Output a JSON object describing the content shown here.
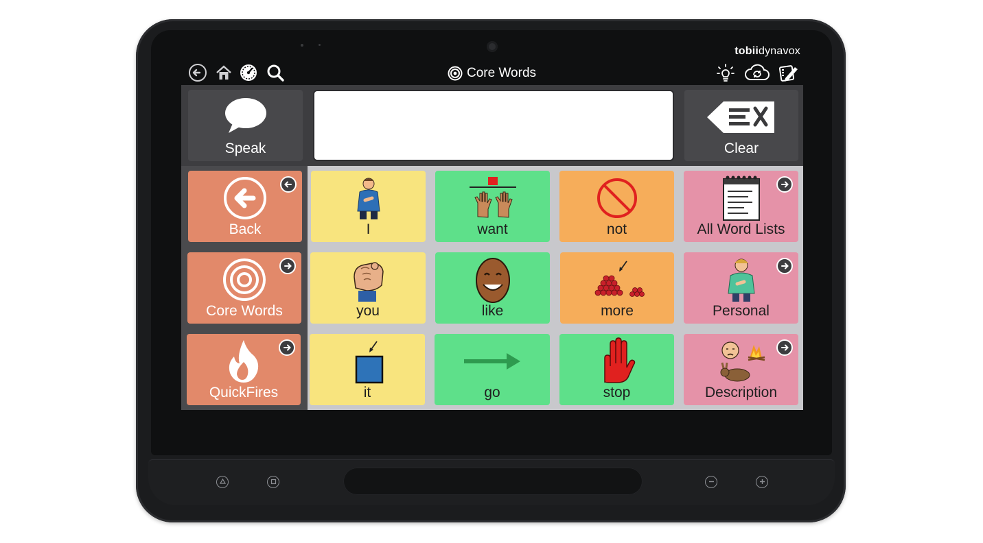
{
  "brand": {
    "prefix": "tobii",
    "suffix": "dynavox"
  },
  "topbar": {
    "title": "Core Words",
    "left_icons": [
      "back-circle-icon",
      "home-icon",
      "dashboard-gauge-icon",
      "search-icon"
    ],
    "right_icons": [
      "lightbulb-icon",
      "cloud-sync-icon",
      "edit-pencil-icon"
    ]
  },
  "speak": {
    "label": "Speak",
    "icon": "speech-bubble-icon"
  },
  "clear": {
    "label": "Clear",
    "icon": "clear-backspace-icon"
  },
  "message_window": {
    "value": ""
  },
  "colors": {
    "nav": "#e2896a",
    "yellow": "#f8e47e",
    "green": "#5ee08a",
    "orange": "#f6ad5a",
    "pink": "#e592a8",
    "dark": "#3d3d40"
  },
  "grid": {
    "rows": [
      [
        {
          "label": "Back",
          "color": "nav",
          "icon": "back-arrow-circle-icon",
          "badge": "back"
        },
        {
          "label": "I",
          "color": "yellow",
          "icon": "person-pointing-self-icon"
        },
        {
          "label": "want",
          "color": "green",
          "icon": "want-hands-icon"
        },
        {
          "label": "not",
          "color": "orange",
          "icon": "not-prohibited-icon"
        },
        {
          "label": "All Word Lists",
          "color": "pink",
          "icon": "notepad-list-icon",
          "badge": "forward"
        }
      ],
      [
        {
          "label": "Core Words",
          "color": "nav",
          "icon": "target-icon",
          "badge": "forward"
        },
        {
          "label": "you",
          "color": "yellow",
          "icon": "pointing-fist-icon"
        },
        {
          "label": "like",
          "color": "green",
          "icon": "smiling-face-icon"
        },
        {
          "label": "more",
          "color": "orange",
          "icon": "more-pile-icon"
        },
        {
          "label": "Personal",
          "color": "pink",
          "icon": "personal-person-icon",
          "badge": "forward"
        }
      ],
      [
        {
          "label": "QuickFires",
          "color": "nav",
          "icon": "flame-icon",
          "badge": "forward"
        },
        {
          "label": "it",
          "color": "yellow",
          "icon": "blue-square-it-icon"
        },
        {
          "label": "go",
          "color": "green",
          "icon": "go-arrow-icon"
        },
        {
          "label": "stop",
          "color": "green",
          "icon": "stop-hand-icon"
        },
        {
          "label": "Description",
          "color": "pink",
          "icon": "description-collage-icon",
          "badge": "forward"
        }
      ]
    ]
  }
}
